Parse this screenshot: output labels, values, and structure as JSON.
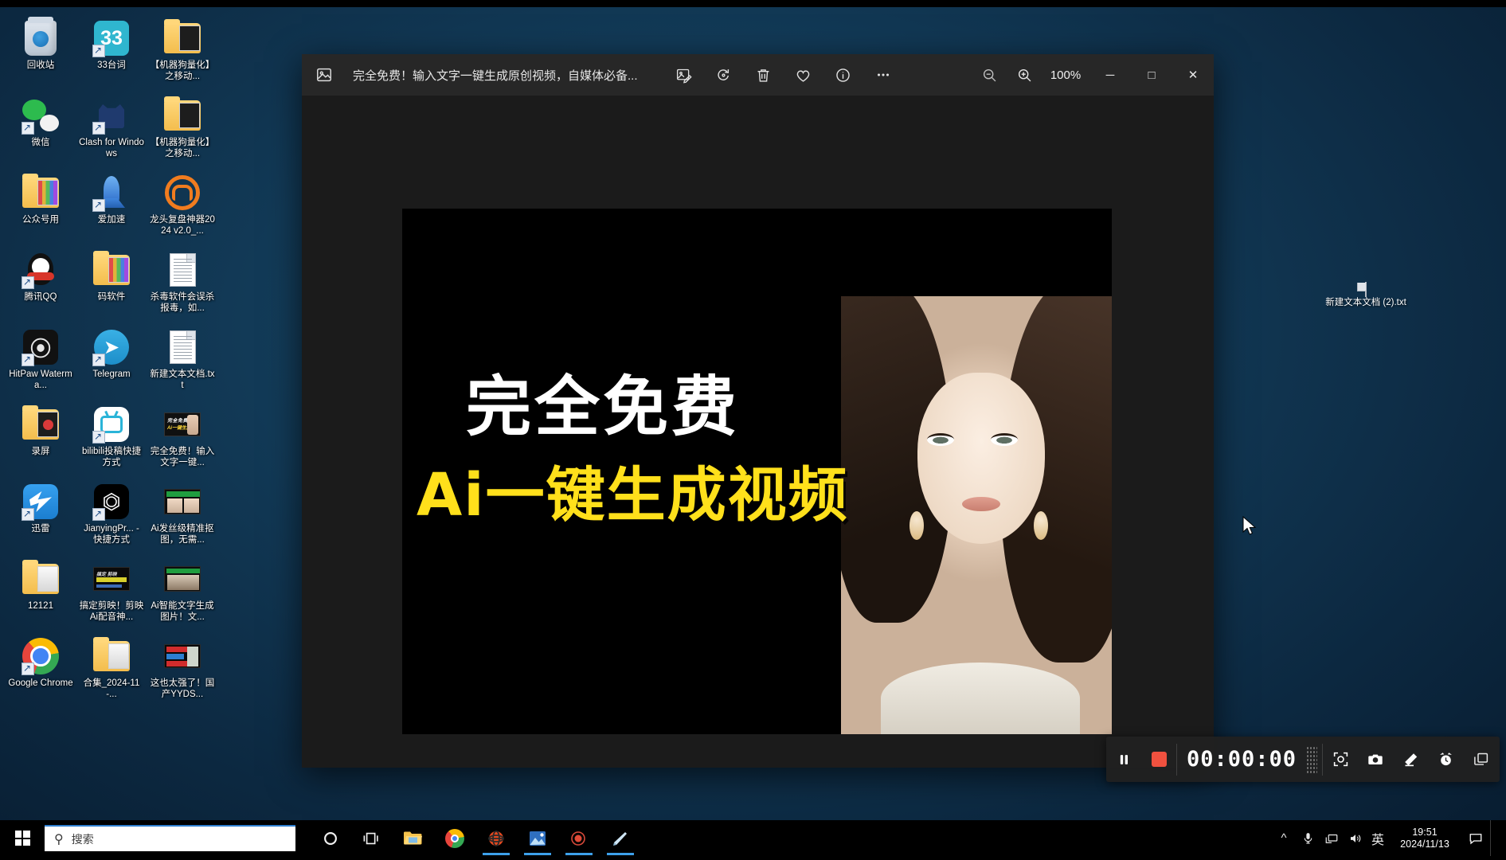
{
  "desktop": {
    "icons": [
      {
        "label": "回收站",
        "icon": "recycle-bin-icon",
        "kind": "recyclebin"
      },
      {
        "label": "33台词",
        "icon": "app-33taici-icon",
        "kind": "sq33",
        "shortcut": true
      },
      {
        "label": "【机器狗量化】之移动...",
        "icon": "folder-icon",
        "kind": "folder-dark"
      },
      {
        "label": "微信",
        "icon": "wechat-icon",
        "kind": "wechat",
        "shortcut": true
      },
      {
        "label": "Clash for Windows",
        "icon": "clash-icon",
        "kind": "clash",
        "shortcut": true
      },
      {
        "label": "【机器狗量化】之移动...",
        "icon": "folder-icon",
        "kind": "folder-dark"
      },
      {
        "label": "公众号用",
        "icon": "folder-icon",
        "kind": "folder-colorful"
      },
      {
        "label": "爱加速",
        "icon": "aijiasu-icon",
        "kind": "rocket",
        "shortcut": true
      },
      {
        "label": "龙头复盘神器2024 v2.0_...",
        "icon": "longtou-icon",
        "kind": "ring"
      },
      {
        "label": "腾讯QQ",
        "icon": "qq-icon",
        "kind": "qq",
        "shortcut": true
      },
      {
        "label": "码软件",
        "icon": "folder-icon",
        "kind": "folder-colorful"
      },
      {
        "label": "杀毒软件会误杀报毒，如...",
        "icon": "text-file-icon",
        "kind": "doc"
      },
      {
        "label": "HitPaw Waterma...",
        "icon": "hitpaw-icon",
        "kind": "hitpaw",
        "shortcut": true
      },
      {
        "label": "Telegram",
        "icon": "telegram-icon",
        "kind": "telegram",
        "shortcut": true
      },
      {
        "label": "新建文本文档.txt",
        "icon": "text-file-icon",
        "kind": "doc"
      },
      {
        "label": "录屏",
        "icon": "folder-icon",
        "kind": "folder-redcirc"
      },
      {
        "label": "bilibili投稿快捷方式",
        "icon": "bilibili-icon",
        "kind": "bili",
        "shortcut": true
      },
      {
        "label": "完全免费！输入文字一键...",
        "icon": "video-thumbnail-icon",
        "kind": "thumb-video"
      },
      {
        "label": "迅雷",
        "icon": "xunlei-icon",
        "kind": "xunlei",
        "shortcut": true
      },
      {
        "label": "JianyingPr... - 快捷方式",
        "icon": "jianying-icon",
        "kind": "jianying",
        "shortcut": true
      },
      {
        "label": "Ai发丝级精准抠图，无需...",
        "icon": "video-thumbnail-icon",
        "kind": "thumb-green"
      },
      {
        "label": "12121",
        "icon": "folder-icon",
        "kind": "folder-docs"
      },
      {
        "label": "搞定剪映！剪映Ai配音神...",
        "icon": "video-thumbnail-icon",
        "kind": "thumb-dark"
      },
      {
        "label": "Ai智能文字生成图片！文...",
        "icon": "video-thumbnail-icon",
        "kind": "thumb-room"
      },
      {
        "label": "Google Chrome",
        "icon": "chrome-icon",
        "kind": "chrome",
        "shortcut": true
      },
      {
        "label": "合集_2024-11-...",
        "icon": "folder-icon",
        "kind": "folder-docs"
      },
      {
        "label": "这也太强了！国产YYDS...",
        "icon": "video-thumbnail-icon",
        "kind": "thumb-yyds"
      }
    ],
    "right_icon": {
      "label": "新建文本文档 (2).txt",
      "icon": "text-file-icon"
    }
  },
  "viewer": {
    "app_icon": "photos-app-icon",
    "title": "完全免费！输入文字一键生成原创视频，自媒体必备...",
    "tools": [
      {
        "name": "edit-image-icon",
        "glyph": "edit"
      },
      {
        "name": "rotate-icon",
        "glyph": "rotate"
      },
      {
        "name": "delete-icon",
        "glyph": "trash"
      },
      {
        "name": "favorite-heart-icon",
        "glyph": "heart"
      },
      {
        "name": "info-icon",
        "glyph": "info"
      },
      {
        "name": "more-options-icon",
        "glyph": "dots"
      }
    ],
    "zoom_out_icon": "zoom-out-icon",
    "zoom_in_icon": "zoom-in-icon",
    "zoom_level": "100%",
    "minimize_label": "─",
    "maximize_label": "□",
    "close_label": "✕",
    "media": {
      "headline_white": "完全免费",
      "headline_yellow": "Ai一键生成视频",
      "headline_white_color": "#ffffff",
      "headline_yellow_color": "#ffe01b",
      "background_color": "#000000"
    }
  },
  "recorder": {
    "pause_icon": "pause-icon",
    "stop_icon": "stop-record-icon",
    "stop_color": "#f0513f",
    "timer": "00:00:00",
    "grip_icon": "drag-grip-icon",
    "buttons": [
      {
        "name": "region-capture-icon",
        "glyph": "region"
      },
      {
        "name": "camera-snapshot-icon",
        "glyph": "camera"
      },
      {
        "name": "annotate-pen-icon",
        "glyph": "pen"
      },
      {
        "name": "alarm-clock-icon",
        "glyph": "alarm"
      },
      {
        "name": "window-capture-icon",
        "glyph": "window"
      }
    ]
  },
  "taskbar": {
    "start_icon": "windows-start-icon",
    "search_placeholder": "搜索",
    "search_icon": "search-icon",
    "apps": [
      {
        "name": "cortana-icon",
        "active": false
      },
      {
        "name": "task-view-icon",
        "active": false
      },
      {
        "name": "file-explorer-icon",
        "active": false
      },
      {
        "name": "google-chrome-icon",
        "active": false
      },
      {
        "name": "browser-globe-icon",
        "active": true
      },
      {
        "name": "photos-app-icon",
        "active": true
      },
      {
        "name": "screen-recorder-icon",
        "active": true
      },
      {
        "name": "onenote-app-icon",
        "active": true
      }
    ],
    "tray": [
      {
        "name": "show-hidden-icons-chevron",
        "glyph": "^"
      },
      {
        "name": "microphone-icon",
        "glyph": "mic"
      },
      {
        "name": "network-display-icon",
        "glyph": "net"
      },
      {
        "name": "volume-icon",
        "glyph": "vol"
      },
      {
        "name": "ime-language-icon",
        "glyph": "英"
      }
    ],
    "clock_time": "19:51",
    "clock_date": "2024/11/13",
    "notification_icon": "action-center-icon"
  }
}
